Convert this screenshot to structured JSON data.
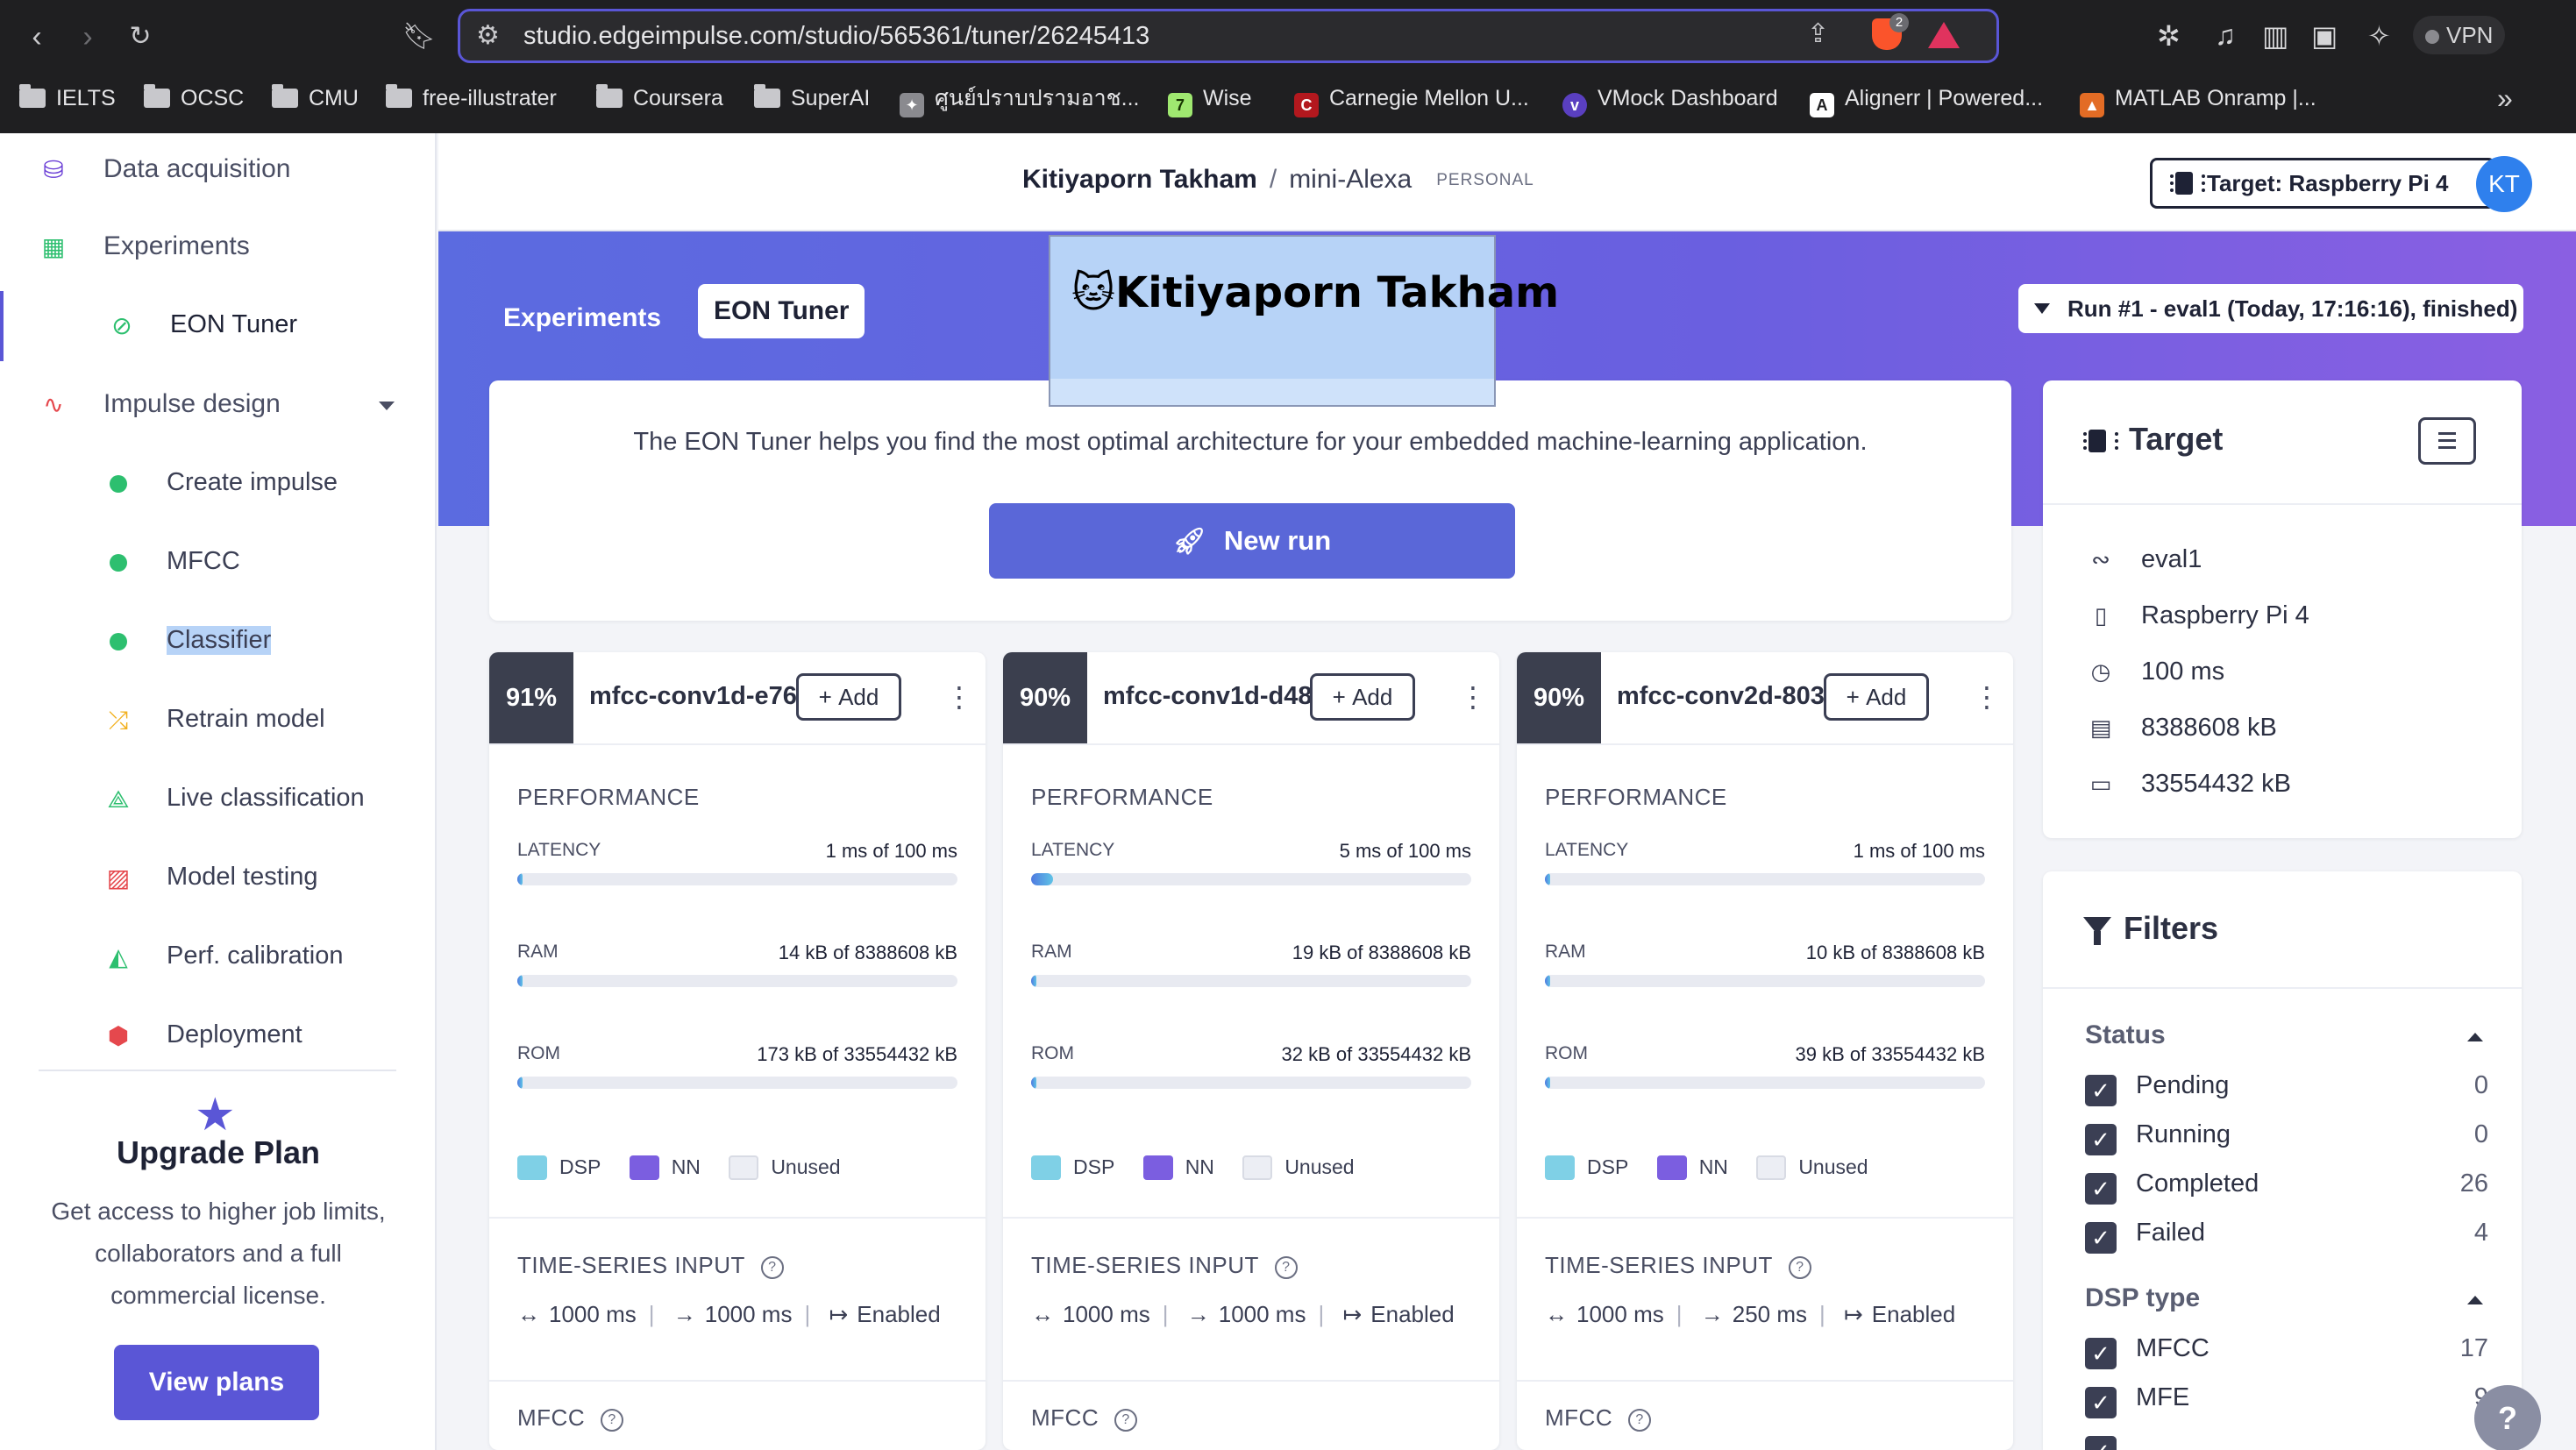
{
  "browser": {
    "url": "studio.edgeimpulse.com/studio/565361/tuner/26245413",
    "brave_badge": "2",
    "vpn_label": "VPN",
    "bookmarks": [
      {
        "label": "IELTS",
        "type": "folder"
      },
      {
        "label": "OCSC",
        "type": "folder"
      },
      {
        "label": "CMU",
        "type": "folder"
      },
      {
        "label": "free-illustrater",
        "type": "folder"
      },
      {
        "label": "Coursera",
        "type": "folder"
      },
      {
        "label": "SuperAI",
        "type": "folder"
      },
      {
        "label": "ศูนย์ปราบปรามอาช...",
        "type": "site",
        "icon": "police-badge-icon"
      },
      {
        "label": "Wise",
        "type": "site",
        "icon": "wise-logo-icon"
      },
      {
        "label": "Carnegie Mellon U...",
        "type": "site",
        "icon": "cmu-logo-icon"
      },
      {
        "label": "VMock Dashboard",
        "type": "site",
        "icon": "vmock-logo-icon"
      },
      {
        "label": "Alignerr | Powered...",
        "type": "site",
        "icon": "alignerr-logo-icon"
      },
      {
        "label": "MATLAB Onramp |...",
        "type": "site",
        "icon": "matlab-logo-icon"
      }
    ]
  },
  "sidebar": {
    "items": [
      {
        "label": "Data acquisition",
        "icon": "database-icon"
      },
      {
        "label": "Experiments",
        "icon": "table-icon"
      },
      {
        "label": "EON Tuner",
        "icon": "compass-icon"
      },
      {
        "label": "Impulse design",
        "icon": "pulse-icon"
      },
      {
        "label": "Create impulse",
        "icon": "green-dot-icon"
      },
      {
        "label": "MFCC",
        "icon": "green-dot-icon"
      },
      {
        "label": "Classifier",
        "icon": "green-dot-icon"
      },
      {
        "label": "Retrain model",
        "icon": "shuffle-icon"
      },
      {
        "label": "Live classification",
        "icon": "graph-icon"
      },
      {
        "label": "Model testing",
        "icon": "clipboard-check-icon"
      },
      {
        "label": "Perf. calibration",
        "icon": "area-chart-icon"
      },
      {
        "label": "Deployment",
        "icon": "package-icon"
      }
    ],
    "upgrade": {
      "title": "Upgrade Plan",
      "text": "Get access to higher job limits, collaborators and a full commercial license.",
      "button": "View plans"
    }
  },
  "header": {
    "owner": "Kitiyaporn Takham",
    "separator": "/",
    "project": "mini-Alexa",
    "badge": "PERSONAL",
    "target_button": "Target: Raspberry Pi 4",
    "avatar_initials": "KT"
  },
  "tabs": {
    "experiments": "Experiments",
    "eon_tuner": "EON Tuner"
  },
  "run_select": "Run #1 - eval1 (Today, 17:16:16), finished)",
  "tooltip": {
    "emoji": "🐱",
    "name": "Kitiyaporn Takham"
  },
  "info": {
    "text": "The EON Tuner helps you find the most optimal architecture for your embedded machine-learning application.",
    "new_run": "New run"
  },
  "labels": {
    "performance": "PERFORMANCE",
    "latency": "LATENCY",
    "ram": "RAM",
    "rom": "ROM",
    "dsp": "DSP",
    "nn": "NN",
    "unused": "Unused",
    "time_series_input": "TIME-SERIES INPUT",
    "mfcc": "MFCC",
    "add": "Add",
    "help": "?"
  },
  "colors": {
    "dsp": "#7fd0e6",
    "nn": "#7b5ee0",
    "unused": "#eceef4",
    "accent": "#5a56d6"
  },
  "results": [
    {
      "accuracy": "91%",
      "name": "mfcc-conv1d-e76",
      "latency": "1 ms of 100 ms",
      "latency_fraction": 0.01,
      "ram": "14 kB of 8388608 kB",
      "ram_fraction": 0.0,
      "rom": "173 kB of 33554432 kB",
      "rom_fraction": 0.0,
      "window": "1000 ms",
      "increase": "1000 ms",
      "zero_pad": "Enabled"
    },
    {
      "accuracy": "90%",
      "name": "mfcc-conv1d-d48",
      "latency": "5 ms of 100 ms",
      "latency_fraction": 0.05,
      "ram": "19 kB of 8388608 kB",
      "ram_fraction": 0.0,
      "rom": "32 kB of 33554432 kB",
      "rom_fraction": 0.0,
      "window": "1000 ms",
      "increase": "1000 ms",
      "zero_pad": "Enabled"
    },
    {
      "accuracy": "90%",
      "name": "mfcc-conv2d-803",
      "latency": "1 ms of 100 ms",
      "latency_fraction": 0.01,
      "ram": "10 kB of 8388608 kB",
      "ram_fraction": 0.0,
      "rom": "39 kB of 33554432 kB",
      "rom_fraction": 0.0,
      "window": "1000 ms",
      "increase": "250 ms",
      "zero_pad": "Enabled"
    }
  ],
  "target_panel": {
    "title": "Target",
    "rows": [
      {
        "value": "eval1",
        "icon": "signature-icon"
      },
      {
        "value": "Raspberry Pi 4",
        "icon": "chip-icon"
      },
      {
        "value": "100 ms",
        "icon": "clock-icon"
      },
      {
        "value": "8388608 kB",
        "icon": "ram-icon"
      },
      {
        "value": "33554432 kB",
        "icon": "rom-icon"
      }
    ]
  },
  "filters": {
    "title": "Filters",
    "status_label": "Status",
    "status": [
      {
        "label": "Pending",
        "count": "0"
      },
      {
        "label": "Running",
        "count": "0"
      },
      {
        "label": "Completed",
        "count": "26"
      },
      {
        "label": "Failed",
        "count": "4"
      }
    ],
    "dsp_label": "DSP type",
    "dsp": [
      {
        "label": "MFCC",
        "count": "17"
      },
      {
        "label": "MFE",
        "count": "9"
      }
    ]
  },
  "help_fab": "?"
}
